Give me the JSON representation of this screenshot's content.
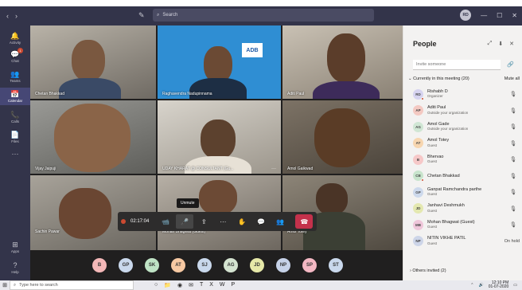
{
  "titlebar": {
    "search_placeholder": "Search",
    "user_initials": "RD"
  },
  "rail": [
    {
      "label": "Activity",
      "icon": "bell-icon",
      "glyph": "🔔"
    },
    {
      "label": "Chat",
      "icon": "chat-icon",
      "glyph": "💬",
      "badge": "1"
    },
    {
      "label": "Teams",
      "icon": "teams-icon",
      "glyph": "👥"
    },
    {
      "label": "Calendar",
      "icon": "calendar-icon",
      "glyph": "📅"
    },
    {
      "label": "Calls",
      "icon": "phone-icon",
      "glyph": "📞"
    },
    {
      "label": "Files",
      "icon": "file-icon",
      "glyph": "📄"
    },
    {
      "label": "",
      "icon": "more-icon",
      "glyph": "···"
    }
  ],
  "rail_bottom": [
    {
      "label": "Apps",
      "icon": "apps-icon",
      "glyph": "⊞"
    },
    {
      "label": "Help",
      "icon": "help-icon",
      "glyph": "?"
    }
  ],
  "videos": [
    {
      "name": "Chetan Bhakkad"
    },
    {
      "name": "Raghavendra Nadupinnama",
      "logo": "ADB"
    },
    {
      "name": "Aditi Paul"
    },
    {
      "name": "Vijay Jaipuji"
    },
    {
      "name": "UDAY KHARAT @ CONSULTANT (Gu..."
    },
    {
      "name": "Amol Gaikwad"
    },
    {
      "name": "Sachin Pawar"
    },
    {
      "name": "Mohan Bhagwat (Guest)"
    },
    {
      "name": "Amol Totey"
    }
  ],
  "callbar": {
    "timer": "02:17:04",
    "tooltip": "Unmute"
  },
  "strip": [
    {
      "initials": "B",
      "color": "#f4b8b8"
    },
    {
      "initials": "GP",
      "color": "#c9d8ec"
    },
    {
      "initials": "SK",
      "color": "#bfe3c5"
    },
    {
      "initials": "AT",
      "color": "#f7c9a3"
    },
    {
      "initials": "SJ",
      "color": "#c9d8ec"
    },
    {
      "initials": "AG",
      "color": "#d4e3d0"
    },
    {
      "initials": "JD",
      "color": "#e6e8a8"
    },
    {
      "initials": "NP",
      "color": "#c6d2e8"
    },
    {
      "initials": "SP",
      "color": "#f4b8c4"
    },
    {
      "initials": "ST",
      "color": "#c9d8ec"
    }
  ],
  "panel": {
    "title": "People",
    "invite_placeholder": "Invite someone",
    "section_label": "Currently in this meeting (20)",
    "mute_all": "Mute all",
    "others": "Others invited (2)",
    "participants": [
      {
        "initials": "RD",
        "name": "Rishabh D",
        "role": "Organizer",
        "color": "#d6d3f0",
        "dot": true
      },
      {
        "initials": "AP",
        "name": "Aditi Paul",
        "role": "Outside your organization",
        "color": "#f4c9c2"
      },
      {
        "initials": "AG",
        "name": "Amol Gade",
        "role": "Outside your organization",
        "color": "#d0e6d4"
      },
      {
        "initials": "AT",
        "name": "Amol Totey",
        "role": "Guest",
        "color": "#f7d6b0"
      },
      {
        "initials": "B",
        "name": "Bhervao",
        "role": "Guest",
        "color": "#f6c8c8"
      },
      {
        "initials": "CB",
        "name": "Chetan Bhakkad",
        "role": "",
        "color": "#c8e4cc",
        "dot": true
      },
      {
        "initials": "GP",
        "name": "Ganpat Ramchandra parthe",
        "role": "Guest",
        "color": "#cdd9ec"
      },
      {
        "initials": "JD",
        "name": "Janhavi Deshmukh",
        "role": "Guest",
        "color": "#e4e8b0"
      },
      {
        "initials": "MB",
        "name": "Mohan Bhagwat (Guest)",
        "role": "Guest",
        "color": "#efc6da"
      },
      {
        "initials": "NP",
        "name": "NITIN VIKHE PATIL",
        "role": "Guest",
        "color": "#cdd5e8",
        "status": "On hold"
      }
    ]
  },
  "taskbar": {
    "search_placeholder": "Type here to search",
    "time": "12:10 PM",
    "date": "01-07-2020"
  }
}
